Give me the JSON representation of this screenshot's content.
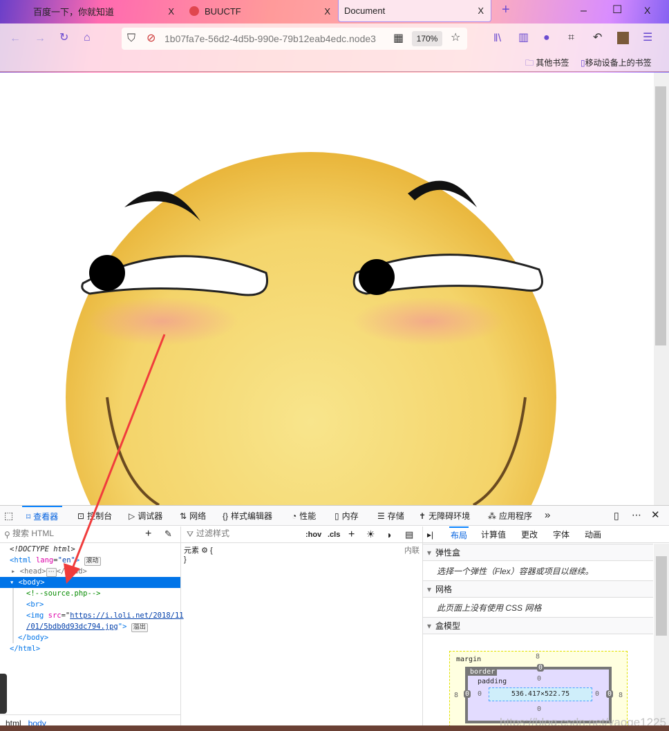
{
  "tabs": [
    {
      "label": "百度一下，你就知道",
      "close": "X"
    },
    {
      "label": "BUUCTF",
      "close": "X"
    },
    {
      "label": "Document",
      "close": "X",
      "active": true
    }
  ],
  "new_tab": "+",
  "window_controls": {
    "minimize": "–",
    "maximize": "☐",
    "close": "X"
  },
  "url": {
    "text": "1b07fa7e-56d2-4d5b-990e-79b12eab4edc.node3",
    "zoom": "170%"
  },
  "bookmarks": [
    {
      "label": "其他书签"
    },
    {
      "label": "移动设备上的书签"
    }
  ],
  "devtools": {
    "tabs": [
      {
        "label": "查看器",
        "selected": true
      },
      {
        "label": "控制台"
      },
      {
        "label": "调试器"
      },
      {
        "label": "网络"
      },
      {
        "label": "样式编辑器"
      },
      {
        "label": "性能"
      },
      {
        "label": "内存"
      },
      {
        "label": "存储"
      },
      {
        "label": "无障碍环境"
      },
      {
        "label": "应用程序"
      }
    ],
    "more": "»",
    "search_placeholder": "搜索 HTML",
    "filter_placeholder": "过滤样式",
    "hov": ":hov",
    "cls": ".cls",
    "tree": {
      "doctype": "<!DOCTYPE html>",
      "html_open": "<html",
      "lang_attr": "lang",
      "lang_val": "\"en\"",
      "html_close_br": ">",
      "scroll_badge": "滚动",
      "head": "<head>",
      "head_close": "</head>",
      "ellipsis": "⋯",
      "body": "<body>",
      "comment": "<!--source.php-->",
      "br": "<br>",
      "img_open": "<img",
      "src_attr": "src",
      "eq": "=\"",
      "src_line1": "https://i.loli.net/2018/11",
      "src_line2": "/01/5bdb0d93dc794.jpg",
      "img_end": "\">",
      "overflow_badge": "溢出",
      "body_close": "</body>",
      "html_close": "</html>"
    },
    "breadcrumb": [
      "html",
      "body"
    ],
    "rules": {
      "element": "元素",
      "open": "{",
      "close": "}",
      "inline": "内联"
    },
    "layout_tabs": [
      {
        "label": "布局",
        "selected": true
      },
      {
        "label": "计算值"
      },
      {
        "label": "更改"
      },
      {
        "label": "字体"
      },
      {
        "label": "动画"
      }
    ],
    "sections": [
      {
        "title": "弹性盒",
        "body": "选择一个弹性（Flex）容器或项目以继续。"
      },
      {
        "title": "网格",
        "body": "此页面上没有使用 CSS 网格"
      },
      {
        "title": "盒模型"
      }
    ],
    "box_model": {
      "margin_label": "margin",
      "border_label": "border",
      "padding_label": "padding",
      "margin": "8",
      "border": "0",
      "padding": "0",
      "content": "536.417×522.75"
    }
  },
  "watermark": "https://blog.csdn.net/yaoge1225",
  "colors": {
    "accent": "#0a84ff",
    "selected_row": "#0074e8",
    "arrow": "#f03c3c"
  }
}
